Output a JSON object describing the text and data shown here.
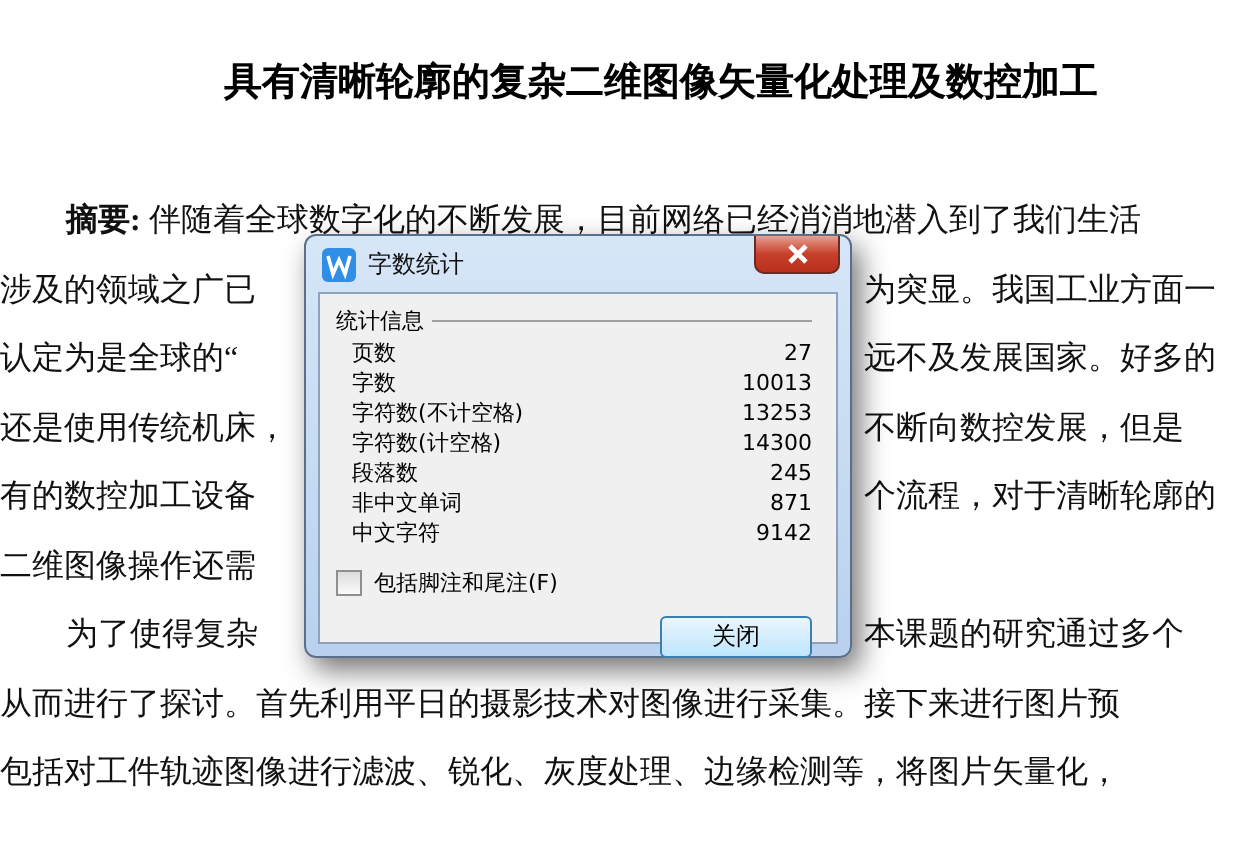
{
  "document": {
    "title": "具有清晰轮廓的复杂二维图像矢量化处理及数控加工",
    "lines": [
      {
        "kind": "paragraph-start",
        "left": "**摘要:** 伴随着全球数字化的不断发展，目前网络已经消消地潜入到了我们生活"
      },
      {
        "kind": "continuation",
        "left": "涉及的领域之广已",
        "right": "为突显。我国工业方面一"
      },
      {
        "kind": "continuation",
        "left": "认定为是全球的“",
        "right": "远不及发展国家。好多的"
      },
      {
        "kind": "continuation",
        "left": "还是使用传统机床，",
        "right": "不断向数控发展，但是"
      },
      {
        "kind": "continuation",
        "left": "有的数控加工设备",
        "right": "个流程，对于清晰轮廓的"
      },
      {
        "kind": "continuation",
        "left": "二维图像操作还需"
      },
      {
        "kind": "paragraph-start",
        "left": "为了使得复杂",
        "right": "本课题的研究通过多个"
      },
      {
        "kind": "continuation",
        "left": "从而进行了探讨。首先利用平日的摄影技术对图像进行采集。接下来进行图片预"
      },
      {
        "kind": "continuation",
        "left": "包括对工件轨迹图像进行滤波、锐化、灰度处理、边缘检测等，将图片矢量化，"
      }
    ]
  },
  "dialog": {
    "title": "字数统计",
    "section": "统计信息",
    "stats": [
      {
        "label": "页数",
        "value": "27"
      },
      {
        "label": "字数",
        "value": "10013"
      },
      {
        "label": "字符数(不计空格)",
        "value": "13253"
      },
      {
        "label": "字符数(计空格)",
        "value": "14300"
      },
      {
        "label": "段落数",
        "value": "245"
      },
      {
        "label": "非中文单词",
        "value": "871"
      },
      {
        "label": "中文字符",
        "value": "9142"
      }
    ],
    "checkbox": {
      "label": "包括脚注和尾注(F)",
      "checked": false
    },
    "buttons": [
      "关闭"
    ]
  }
}
